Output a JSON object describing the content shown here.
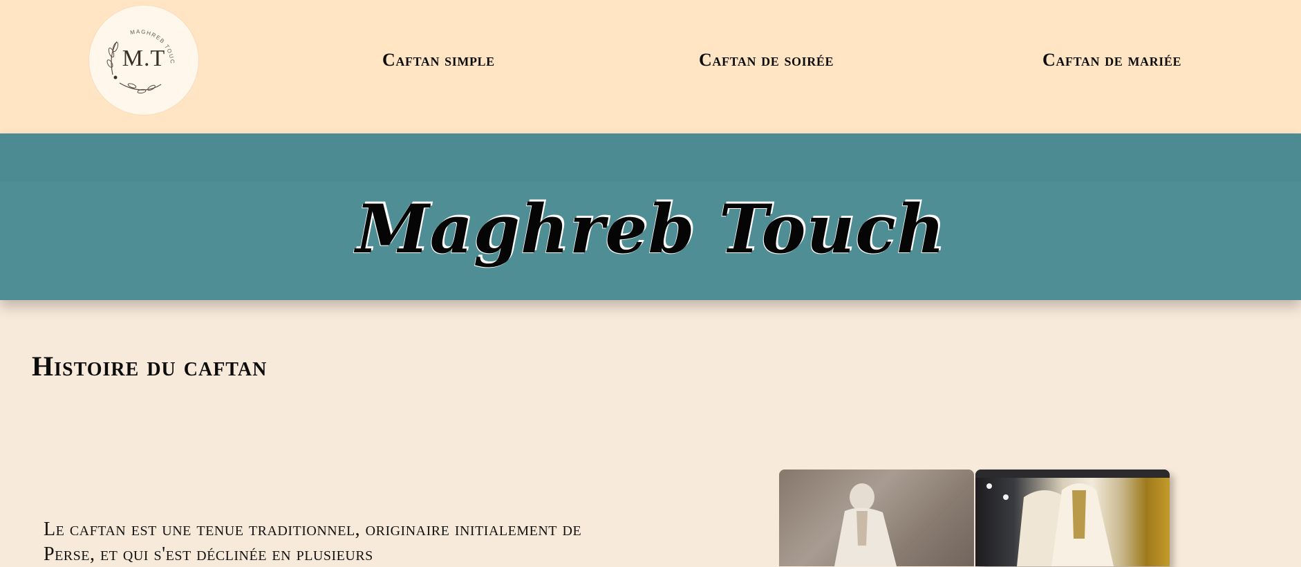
{
  "header": {
    "logo_text": "M.T",
    "logo_arc_text": "MAGHREB TOUCH",
    "nav": [
      {
        "label": "Caftan simple"
      },
      {
        "label": "Caftan de soirée"
      },
      {
        "label": "Caftan de mariée"
      }
    ]
  },
  "hero": {
    "title": "Maghreb Touch",
    "background": "#4f8e94"
  },
  "main": {
    "section_title": "Histoire du caftan",
    "intro": "Le caftan est une tenue traditionnel, originaire initialement de Perse, et qui s'est déclinée en plusieurs"
  },
  "colors": {
    "topbar": "#ffe5c3",
    "page": "#f8eadb"
  },
  "icons": {
    "logo_leaf": "leaf-branch-icon"
  }
}
